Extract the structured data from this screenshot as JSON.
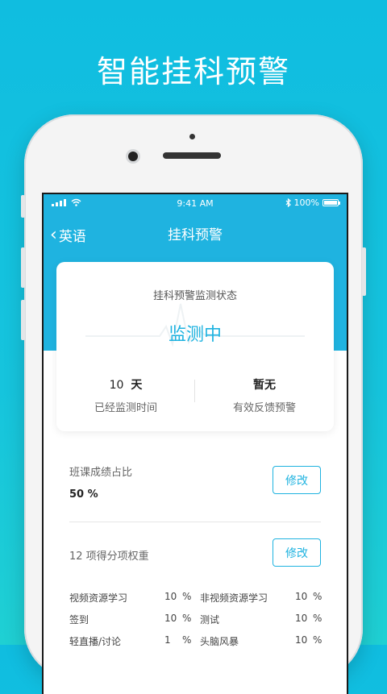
{
  "headline": "智能挂科预警",
  "status_bar": {
    "time": "9:41 AM",
    "battery": "100%"
  },
  "nav": {
    "back_label": "英语",
    "title": "挂科预警"
  },
  "card": {
    "label": "挂科预警监测状态",
    "status": "监测中",
    "days_value": "10",
    "days_unit": "天",
    "days_desc": "已经监测时间",
    "feedback_value": "暂无",
    "feedback_desc": "有效反馈预警"
  },
  "score_ratio": {
    "label": "班课成绩占比",
    "value": "50 %",
    "edit_label": "修改"
  },
  "weights": {
    "label": "12 项得分项权重",
    "edit_label": "修改",
    "rows": [
      {
        "left_name": "视频资源学习",
        "left_value": "10",
        "right_name": "非视频资源学习",
        "right_value": "10"
      },
      {
        "left_name": "签到",
        "left_value": "10",
        "right_name": "测试",
        "right_value": "10"
      },
      {
        "left_name": "轻直播/讨论",
        "left_value": "1",
        "right_name": "头脑风暴",
        "right_value": "10"
      }
    ],
    "unit": "%"
  },
  "colors": {
    "accent": "#1fb3e0",
    "background": "#14c0de"
  }
}
